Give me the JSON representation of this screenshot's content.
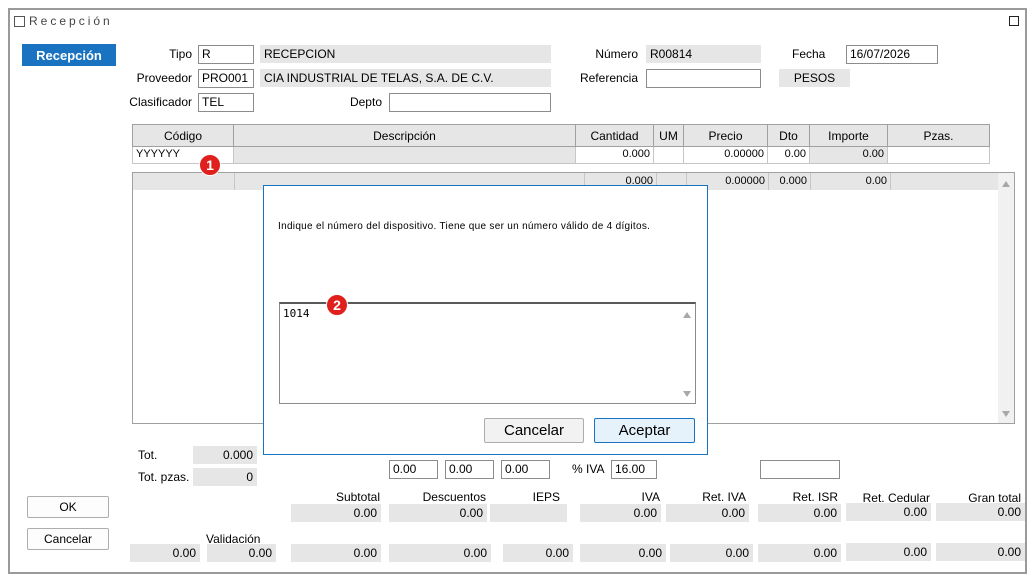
{
  "window": {
    "title": "Recepción"
  },
  "section_button": "Recepción",
  "header": {
    "tipo_label": "Tipo",
    "tipo_code": "R",
    "tipo_desc": "RECEPCION",
    "proveedor_label": "Proveedor",
    "proveedor_code": "PRO001",
    "proveedor_desc": "CIA INDUSTRIAL DE TELAS, S.A. DE C.V.",
    "clasificador_label": "Clasificador",
    "clasificador_code": "TEL",
    "depto_label": "Depto",
    "depto_value": "",
    "numero_label": "Número",
    "numero_value": "R00814",
    "referencia_label": "Referencia",
    "referencia_value": "",
    "fecha_label": "Fecha",
    "fecha_value": "16/07/2026",
    "moneda": "PESOS"
  },
  "grid": {
    "columns": [
      "Código",
      "Descripción",
      "Cantidad",
      "UM",
      "Precio",
      "Dto",
      "Importe",
      "Pzas."
    ],
    "entry_row": {
      "codigo": "YYYYYY",
      "descripcion": "",
      "cantidad": "0.000",
      "um": "",
      "precio": "0.00000",
      "dto": "0.00",
      "importe": "0.00",
      "pzas": ""
    },
    "list_header": {
      "cantidad": "0.000",
      "precio": "0.00000",
      "dto": "0.000",
      "importe": "0.00"
    }
  },
  "dialog": {
    "message": "Indique el número del dispositivo. Tiene que ser un número válido de 4 dígitos.",
    "input_value": "1014",
    "cancel_label": "Cancelar",
    "accept_label": "Aceptar"
  },
  "badges": {
    "one": "1",
    "two": "2"
  },
  "totals": {
    "tot_label": "Tot.",
    "tot_value": "0.000",
    "tot_pzas_label": "Tot. pzas.",
    "tot_pzas_value": "0",
    "f1": "0.00",
    "f2": "0.00",
    "f3": "0.00",
    "iva_pct_label": "% IVA",
    "iva_pct_value": "16.00",
    "extra_field": ""
  },
  "buttons": {
    "ok": "OK",
    "cancel": "Cancelar"
  },
  "summary": {
    "validacion_label": "Validación",
    "labels": [
      "Subtotal",
      "Descuentos",
      "IEPS",
      "IVA",
      "Ret. IVA",
      "Ret. ISR",
      "Ret. Cedular",
      "Gran total"
    ],
    "row1": [
      "0.00",
      "0.00",
      "",
      "0.00",
      "0.00",
      "0.00",
      "0.00",
      "0.00"
    ],
    "row2_left": [
      "0.00",
      "0.00"
    ],
    "row2": [
      "0.00",
      "0.00",
      "0.00",
      "0.00",
      "0.00",
      "0.00",
      "0.00",
      "0.00"
    ]
  },
  "colors": {
    "accent": "#1a73c0",
    "badge": "#e0201c",
    "readonly": "#e6e6e6"
  },
  "icons": {
    "window_checkbox": "checkbox-icon",
    "maximize": "maximize-icon",
    "scroll_up": "scroll-up-icon",
    "scroll_down": "scroll-down-icon"
  }
}
